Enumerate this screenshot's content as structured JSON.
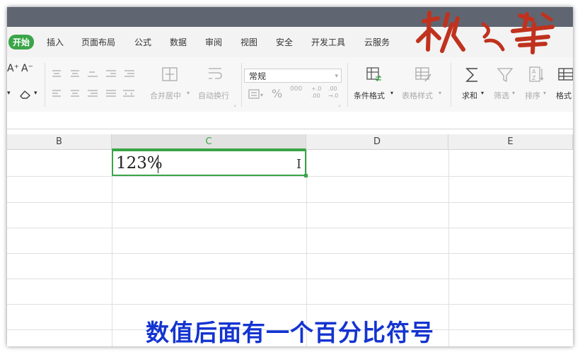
{
  "menu": {
    "items": [
      "开始",
      "插入",
      "页面布局",
      "公式",
      "数据",
      "审阅",
      "视图",
      "安全",
      "开发工具",
      "云服务"
    ]
  },
  "logo_text": "秋叶",
  "ribbon": {
    "font_size_up": "A⁺",
    "font_size_down": "A⁻",
    "merge_center": "合并居中",
    "wrap_text": "自动换行",
    "number_format": "常规",
    "percent": "%",
    "thousands": "000",
    "dec_inc": "+.0 .00",
    "dec_dec": ".00 →.0",
    "conditional_format": "条件格式",
    "table_style": "表格样式",
    "sum": "求和",
    "filter": "筛选",
    "sort": "排序",
    "format": "格式"
  },
  "columns": [
    "B",
    "C",
    "D",
    "E"
  ],
  "cell": {
    "value": "123%"
  },
  "caption": "数值后面有一个百分比符号",
  "colors": {
    "accent": "#3aa548",
    "caption": "#1434d0",
    "logo": "#c0321e"
  }
}
